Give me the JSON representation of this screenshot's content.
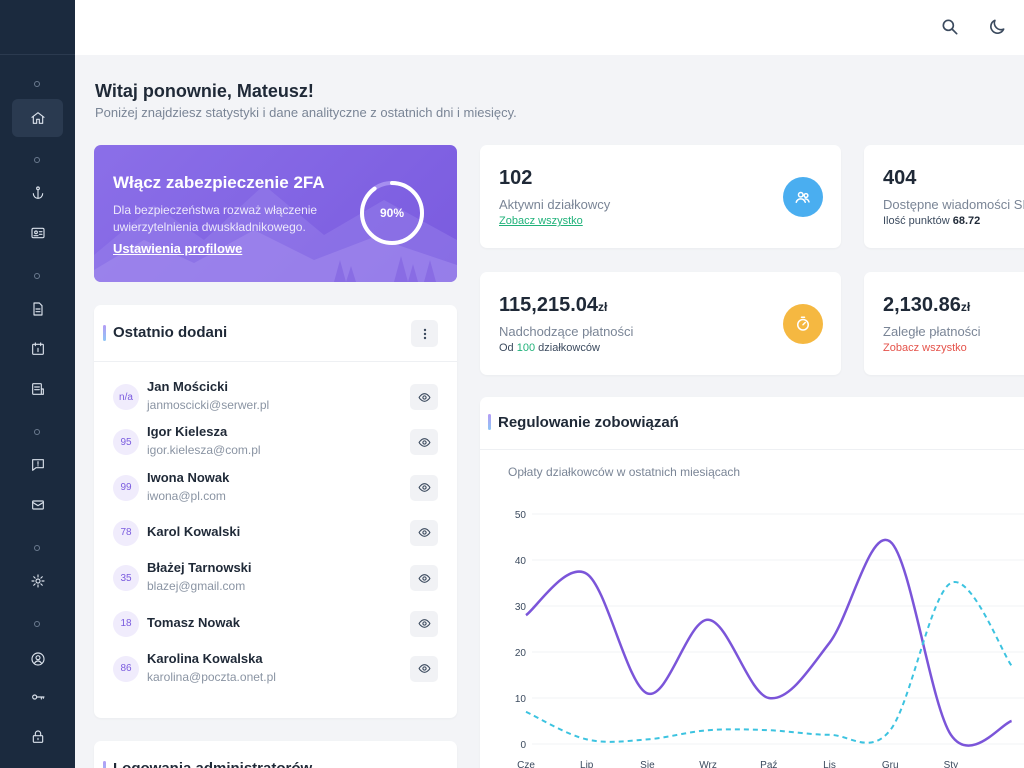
{
  "welcome": {
    "title": "Witaj ponownie, Mateusz!",
    "subtitle": "Poniżej znajdziesz statystyki i dane analityczne z ostatnich dni i miesięcy."
  },
  "promo": {
    "title": "Włącz zabezpieczenie 2FA",
    "text": "Dla bezpieczeństwa rozważ włączenie uwierzytelnienia dwuskładnikowego.",
    "link": "Ustawienia profilowe",
    "progress_label": "90%",
    "progress": 0.9
  },
  "recent": {
    "title": "Ostatnio dodani",
    "items": [
      {
        "initials": "n/a",
        "name": "Jan Mościcki",
        "email": "janmoscicki@serwer.pl"
      },
      {
        "initials": "95",
        "name": "Igor Kielesza",
        "email": "igor.kielesza@com.pl"
      },
      {
        "initials": "99",
        "name": "Iwona Nowak",
        "email": "iwona@pl.com"
      },
      {
        "initials": "78",
        "name": "Karol Kowalski",
        "email": ""
      },
      {
        "initials": "35",
        "name": "Błażej Tarnowski",
        "email": "blazej@gmail.com"
      },
      {
        "initials": "18",
        "name": "Tomasz Nowak",
        "email": ""
      },
      {
        "initials": "86",
        "name": "Karolina Kowalska",
        "email": "karolina@poczta.onet.pl"
      }
    ]
  },
  "admin_logins": {
    "title": "Logowania administratorów"
  },
  "stats": {
    "active": {
      "value": "102",
      "label": "Aktywni działkowcy",
      "link": "Zobacz wszystko"
    },
    "messages": {
      "value": "404",
      "label": "Dostępne wiadomości SMS",
      "sub_prefix": "Ilość punktów",
      "sub_value": "68.72"
    },
    "upcoming": {
      "value": "115,215.04",
      "unit": "zł",
      "label": "Nadchodzące płatności",
      "sub_prefix": "Od",
      "sub_value": "100",
      "sub_suffix": "działkowców"
    },
    "overdue": {
      "value": "2,130.86",
      "unit": "zł",
      "label": "Zaległe płatności",
      "link": "Zobacz wszystko"
    }
  },
  "chart_card": {
    "title": "Regulowanie zobowiązań",
    "subtitle": "Opłaty działkowców w ostatnich miesiącach"
  },
  "colors": {
    "sidebar": "#1b2a3e",
    "accent_purple": "#7a5bdf",
    "series_a": "#7b55d9",
    "series_b": "#3cc3e0",
    "icon_blue": "#4aaef0",
    "icon_orange": "#f5b841"
  },
  "icons": {
    "sidebar": [
      "home-icon",
      "anchor-icon",
      "id-card-icon",
      "document-icon",
      "calendar-icon",
      "report-icon",
      "alert-icon",
      "mail-icon",
      "settings-icon",
      "user-icon",
      "key-icon",
      "lock-icon"
    ],
    "topbar": [
      "search-icon",
      "moon-icon"
    ],
    "stats": [
      "users-icon",
      "timer-icon"
    ]
  },
  "chart_data": {
    "type": "line",
    "categories": [
      "Cze",
      "Lip",
      "Sie",
      "Wrz",
      "Paź",
      "Lis",
      "Gru",
      "Sty"
    ],
    "ylim": [
      0,
      50
    ],
    "yticks": [
      0,
      10,
      20,
      30,
      40,
      50
    ],
    "series": [
      {
        "values": [
          28,
          37,
          11,
          27,
          10,
          22,
          44,
          2,
          5
        ],
        "style": "solid"
      },
      {
        "values": [
          7,
          1,
          1,
          3,
          3,
          2,
          3,
          35,
          17
        ],
        "style": "dashed"
      }
    ]
  }
}
